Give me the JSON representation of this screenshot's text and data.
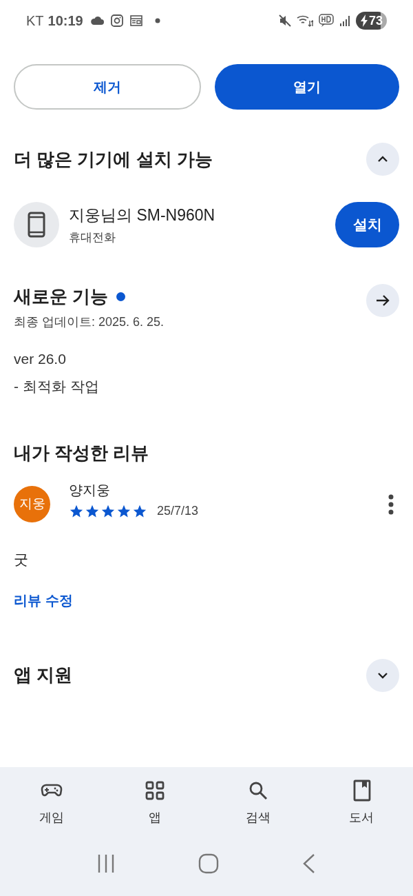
{
  "status_bar": {
    "carrier": "KT",
    "time": "10:19",
    "battery": "73"
  },
  "actions": [
    {
      "label": "제거",
      "kind": "outlined"
    },
    {
      "label": "열기",
      "kind": "filled"
    }
  ],
  "install_section": {
    "title": "더 많은 기기에 설치 가능",
    "expanded": true,
    "devices": [
      {
        "name": "지웅님의 SM-N960N",
        "type": "휴대전화",
        "button": "설치"
      }
    ]
  },
  "whats_new": {
    "title": "새로운 기능",
    "new_indicator": true,
    "date": "최종 업데이트: 2025. 6. 25.",
    "notes": [
      "ver 26.0",
      "- 최적화 작업"
    ]
  },
  "my_review": {
    "title": "내가 작성한 리뷰",
    "reviewer": {
      "initials": "지웅",
      "name": "양지웅",
      "color": "#e8710a"
    },
    "stars": 5,
    "date": "25/7/13",
    "text": "굿",
    "edit_link": "리뷰 수정"
  },
  "app_support": {
    "title": "앱 지원",
    "expanded": false
  },
  "bottom_nav": [
    {
      "label": "게임"
    },
    {
      "label": "앱"
    },
    {
      "label": "검색"
    },
    {
      "label": "도서"
    }
  ]
}
